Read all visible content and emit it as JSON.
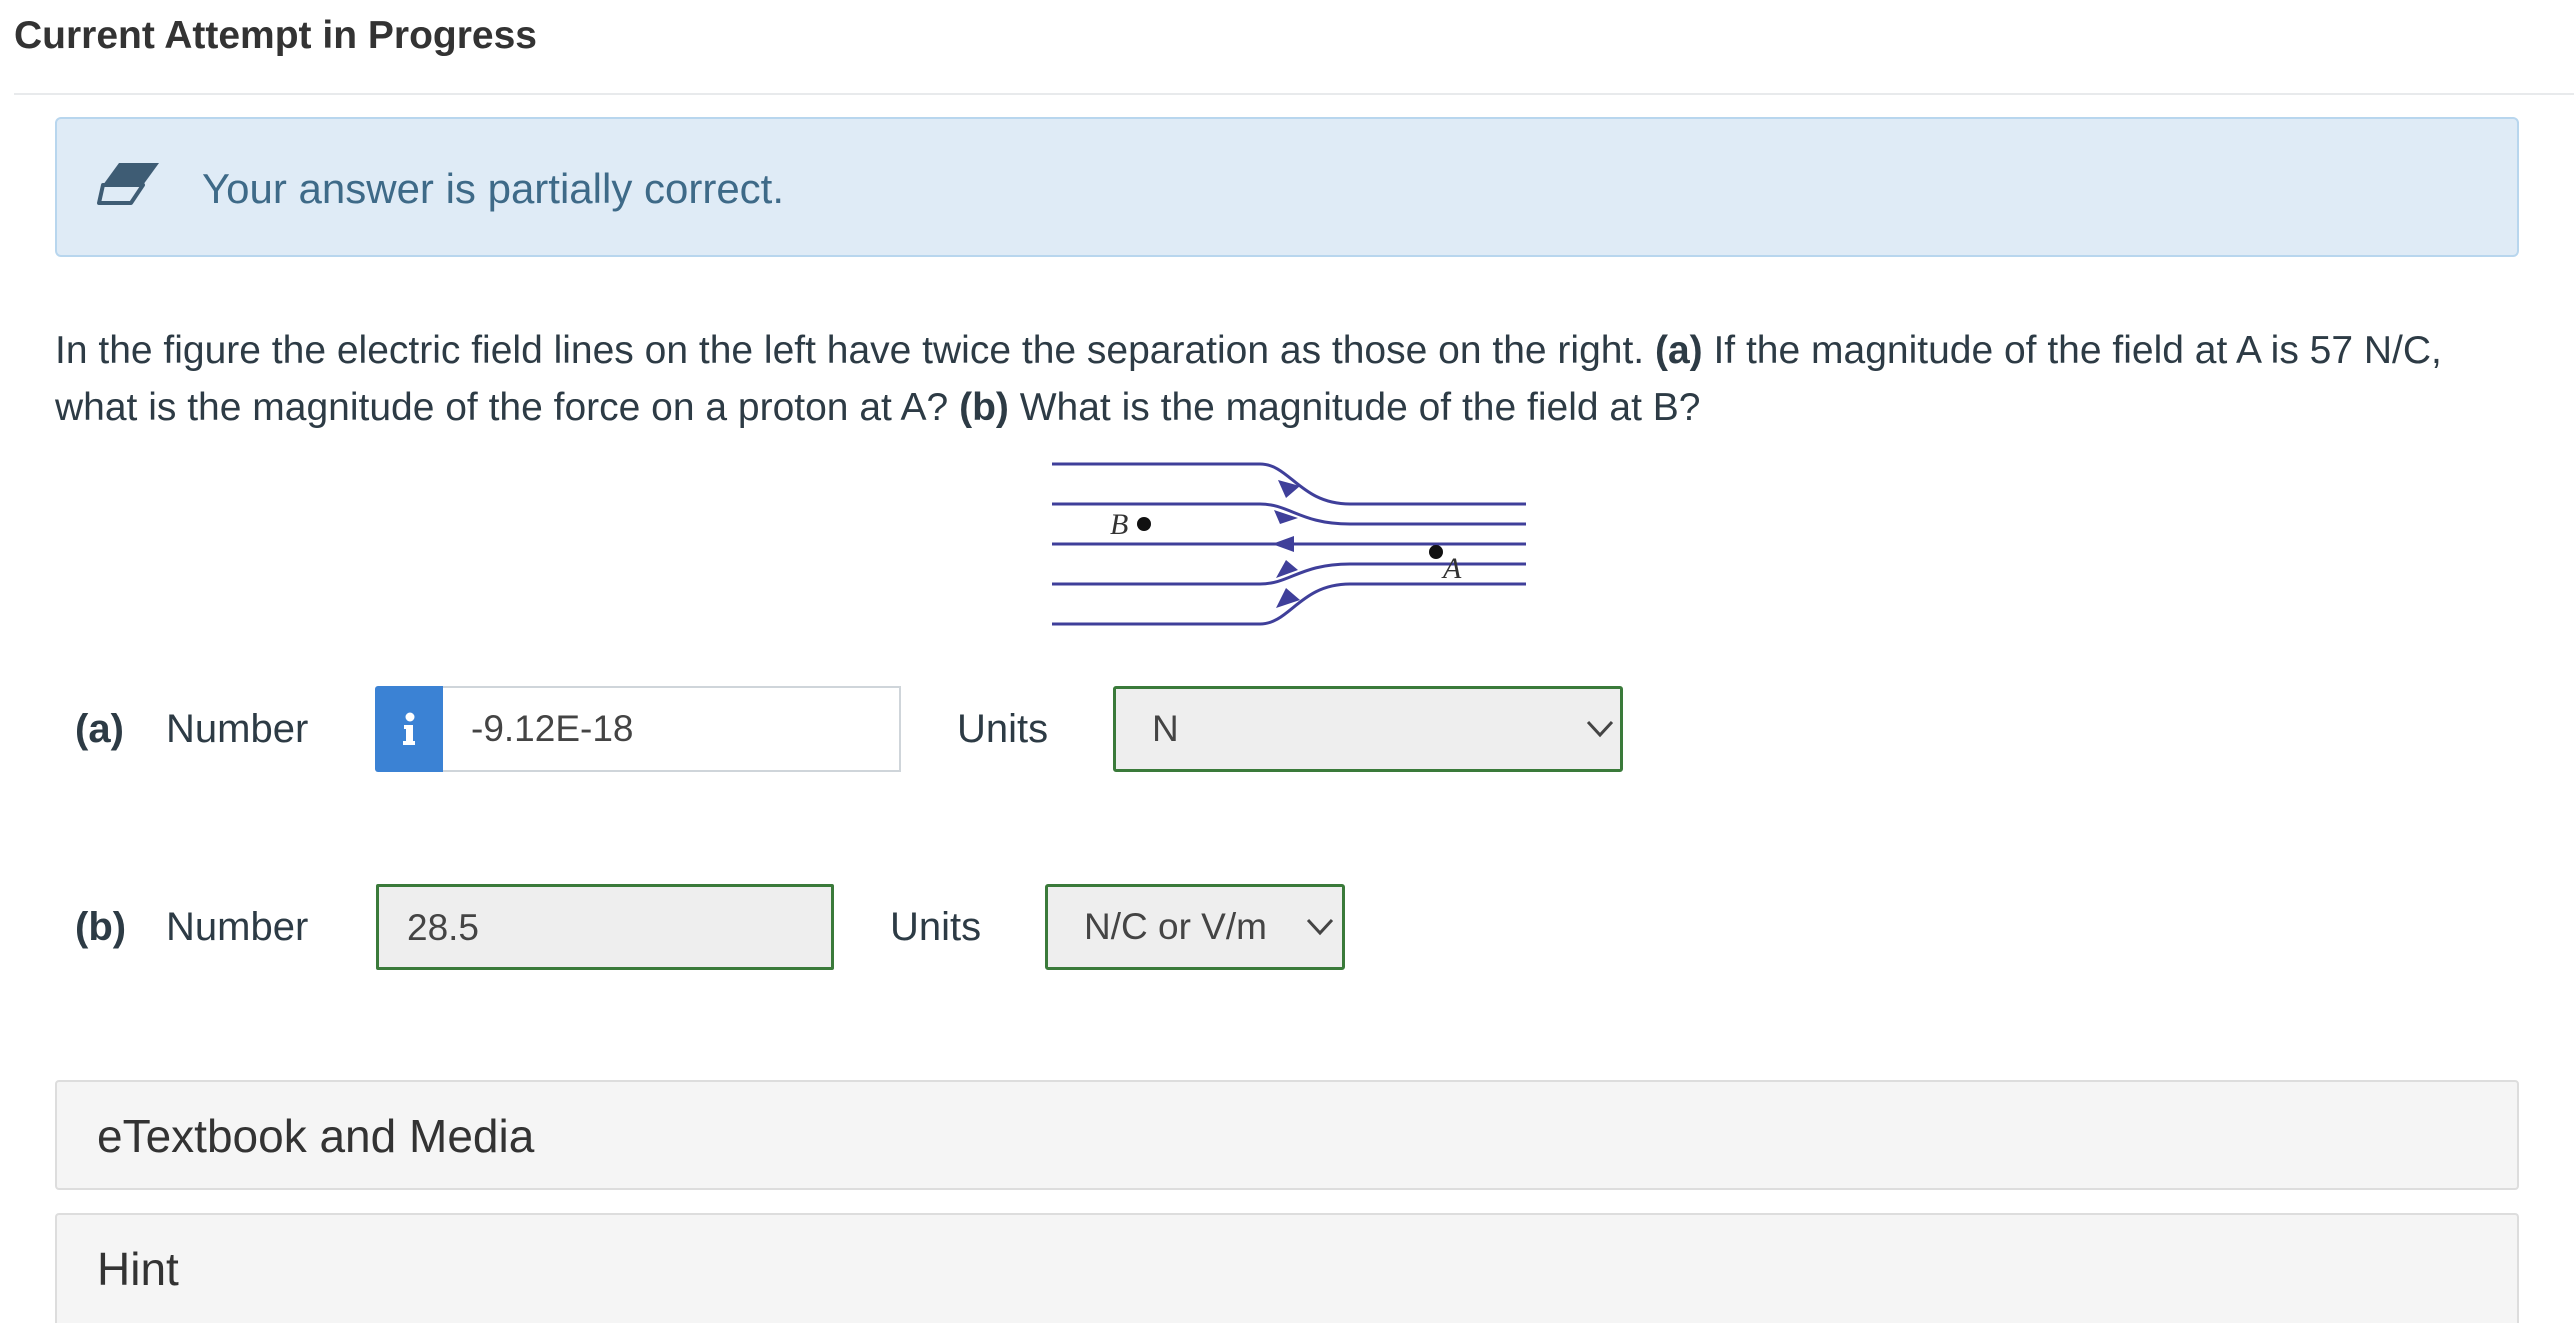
{
  "page": {
    "title": "Current Attempt in Progress"
  },
  "feedback": {
    "text": "Your answer is partially correct.",
    "icon": "eraser-icon"
  },
  "question": {
    "intro": "In the figure the electric field lines on the left have twice the separation as those on the right. ",
    "part_a_tag": "(a)",
    "part_a_text": " If the magnitude of the field at A is 57 N/C, what is the magnitude of the force on a proton at A? ",
    "part_b_tag": "(b)",
    "part_b_text": " What is the magnitude of the field at B?"
  },
  "figure": {
    "label_b": "B",
    "label_a": "A"
  },
  "answers": {
    "a": {
      "label": "(a)",
      "number_label": "Number",
      "value": "-9.12E-18",
      "units_label": "Units",
      "unit": "N",
      "info_icon": "info-icon"
    },
    "b": {
      "label": "(b)",
      "number_label": "Number",
      "value": "28.5",
      "units_label": "Units",
      "unit": "N/C or V/m"
    }
  },
  "panels": {
    "etextbook": "eTextbook and Media",
    "hint": "Hint"
  },
  "colors": {
    "accent": "#3b82d4",
    "correct_border": "#3a7a3a",
    "alert_bg": "#dfebf6",
    "alert_text": "#3e6a88",
    "field_lines": "#3f3f9a"
  }
}
